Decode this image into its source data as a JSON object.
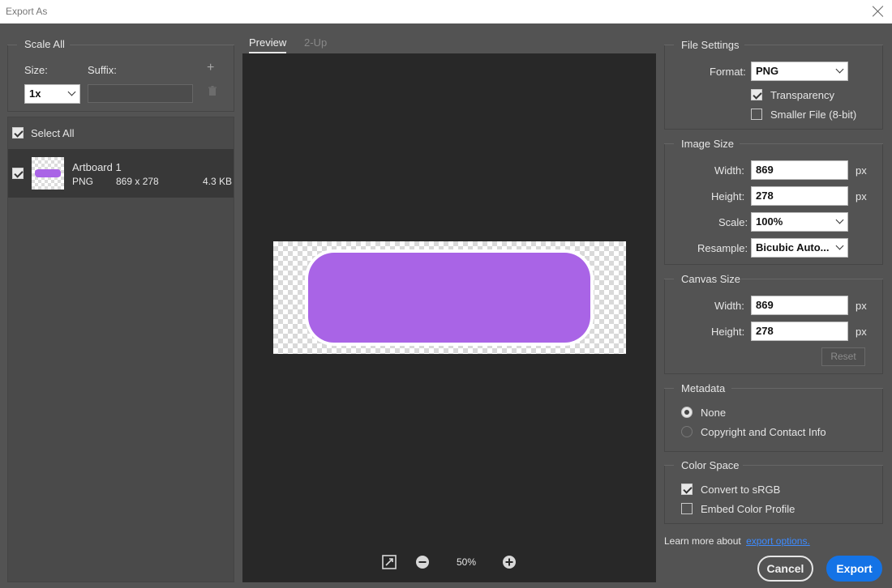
{
  "window": {
    "title": "Export As"
  },
  "left": {
    "scale_all_title": "Scale All",
    "size_label": "Size:",
    "suffix_label": "Suffix:",
    "size_value": "1x",
    "suffix_value": "",
    "add_icon": "plus-icon",
    "delete_icon": "trash-icon",
    "select_all": "Select All",
    "items": [
      {
        "name": "Artboard 1",
        "format": "PNG",
        "dimensions": "869 x 278",
        "filesize": "4.3 KB"
      }
    ]
  },
  "preview": {
    "tabs": [
      "Preview",
      "2-Up"
    ],
    "zoom": "50%",
    "artwork_color": "#a964e6"
  },
  "file_settings": {
    "title": "File Settings",
    "format_label": "Format:",
    "format_value": "PNG",
    "transparency_label": "Transparency",
    "transparency_checked": true,
    "smaller_file_label": "Smaller File (8-bit)",
    "smaller_file_checked": false
  },
  "image_size": {
    "title": "Image Size",
    "width_label": "Width:",
    "width_value": "869",
    "height_label": "Height:",
    "height_value": "278",
    "scale_label": "Scale:",
    "scale_value": "100%",
    "resample_label": "Resample:",
    "resample_value": "Bicubic Auto...",
    "unit": "px"
  },
  "canvas_size": {
    "title": "Canvas Size",
    "width_label": "Width:",
    "width_value": "869",
    "height_label": "Height:",
    "height_value": "278",
    "unit": "px",
    "reset_label": "Reset"
  },
  "metadata": {
    "title": "Metadata",
    "options": [
      "None",
      "Copyright and Contact Info"
    ],
    "selected": "None"
  },
  "color_space": {
    "title": "Color Space",
    "convert_label": "Convert to sRGB",
    "convert_checked": true,
    "embed_label": "Embed Color Profile",
    "embed_checked": false
  },
  "footer": {
    "learn_more": "Learn more about",
    "link_text": "export options.",
    "cancel": "Cancel",
    "export": "Export"
  }
}
